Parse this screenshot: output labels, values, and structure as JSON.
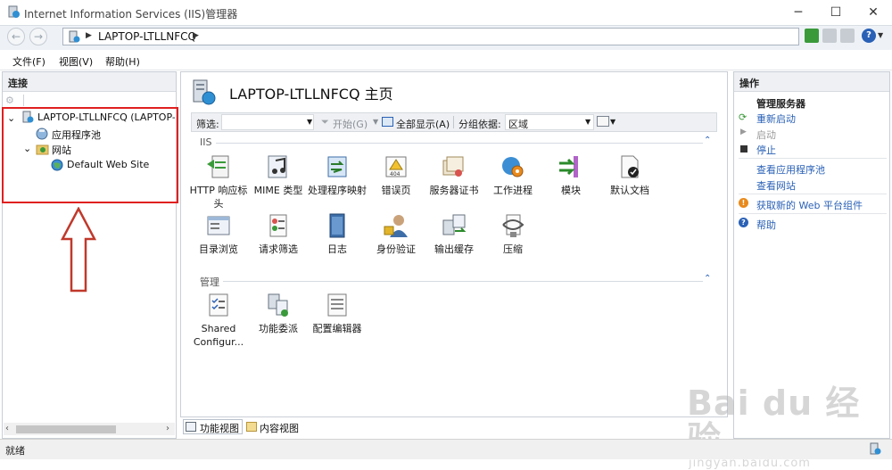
{
  "window": {
    "title": "Internet Information Services (IIS)管理器"
  },
  "address": {
    "path": "LAPTOP-LTLLNFCQ"
  },
  "menu": {
    "file": "文件(F)",
    "view": "视图(V)",
    "help": "帮助(H)"
  },
  "connections": {
    "header": "连接",
    "server": "LAPTOP-LTLLNFCQ (LAPTOP-LT",
    "app_pools": "应用程序池",
    "sites": "网站",
    "default_site": "Default Web Site"
  },
  "main": {
    "title": "LAPTOP-LTLLNFCQ 主页",
    "filter_label": "筛选:",
    "start_label": "开始(G)",
    "show_all_label": "全部显示(A)",
    "group_by_label": "分组依据:",
    "group_by_value": "区域",
    "section_iis": "IIS",
    "section_mgmt": "管理",
    "iis_row1": [
      {
        "label": "HTTP 响应标头",
        "icon": "http-headers-icon"
      },
      {
        "label": "MIME 类型",
        "icon": "mime-types-icon"
      },
      {
        "label": "处理程序映射",
        "icon": "handler-mappings-icon"
      },
      {
        "label": "错误页",
        "icon": "error-pages-icon"
      },
      {
        "label": "服务器证书",
        "icon": "server-certificates-icon"
      },
      {
        "label": "工作进程",
        "icon": "worker-processes-icon"
      },
      {
        "label": "模块",
        "icon": "modules-icon"
      },
      {
        "label": "默认文档",
        "icon": "default-document-icon"
      }
    ],
    "iis_row2": [
      {
        "label": "目录浏览",
        "icon": "directory-browsing-icon"
      },
      {
        "label": "请求筛选",
        "icon": "request-filtering-icon"
      },
      {
        "label": "日志",
        "icon": "logging-icon"
      },
      {
        "label": "身份验证",
        "icon": "authentication-icon"
      },
      {
        "label": "输出缓存",
        "icon": "output-caching-icon"
      },
      {
        "label": "压缩",
        "icon": "compression-icon"
      }
    ],
    "mgmt_row": [
      {
        "label": "Shared Configur...",
        "icon": "shared-config-icon"
      },
      {
        "label": "功能委派",
        "icon": "feature-delegation-icon"
      },
      {
        "label": "配置编辑器",
        "icon": "config-editor-icon"
      }
    ],
    "tab_features": "功能视图",
    "tab_content": "内容视图"
  },
  "actions": {
    "header": "操作",
    "manage_server": "管理服务器",
    "restart": "重新启动",
    "start": "启动",
    "stop": "停止",
    "view_app_pools": "查看应用程序池",
    "view_sites": "查看网站",
    "get_web_platform": "获取新的 Web 平台组件",
    "help": "帮助"
  },
  "status": {
    "text": "就绪"
  },
  "watermark": {
    "brand": "Bai du 经验",
    "url": "jingyan.baidu.com"
  },
  "colors": {
    "accent": "#2a61b6",
    "highlight_box": "#e02020",
    "arrow": "#c0392b"
  }
}
